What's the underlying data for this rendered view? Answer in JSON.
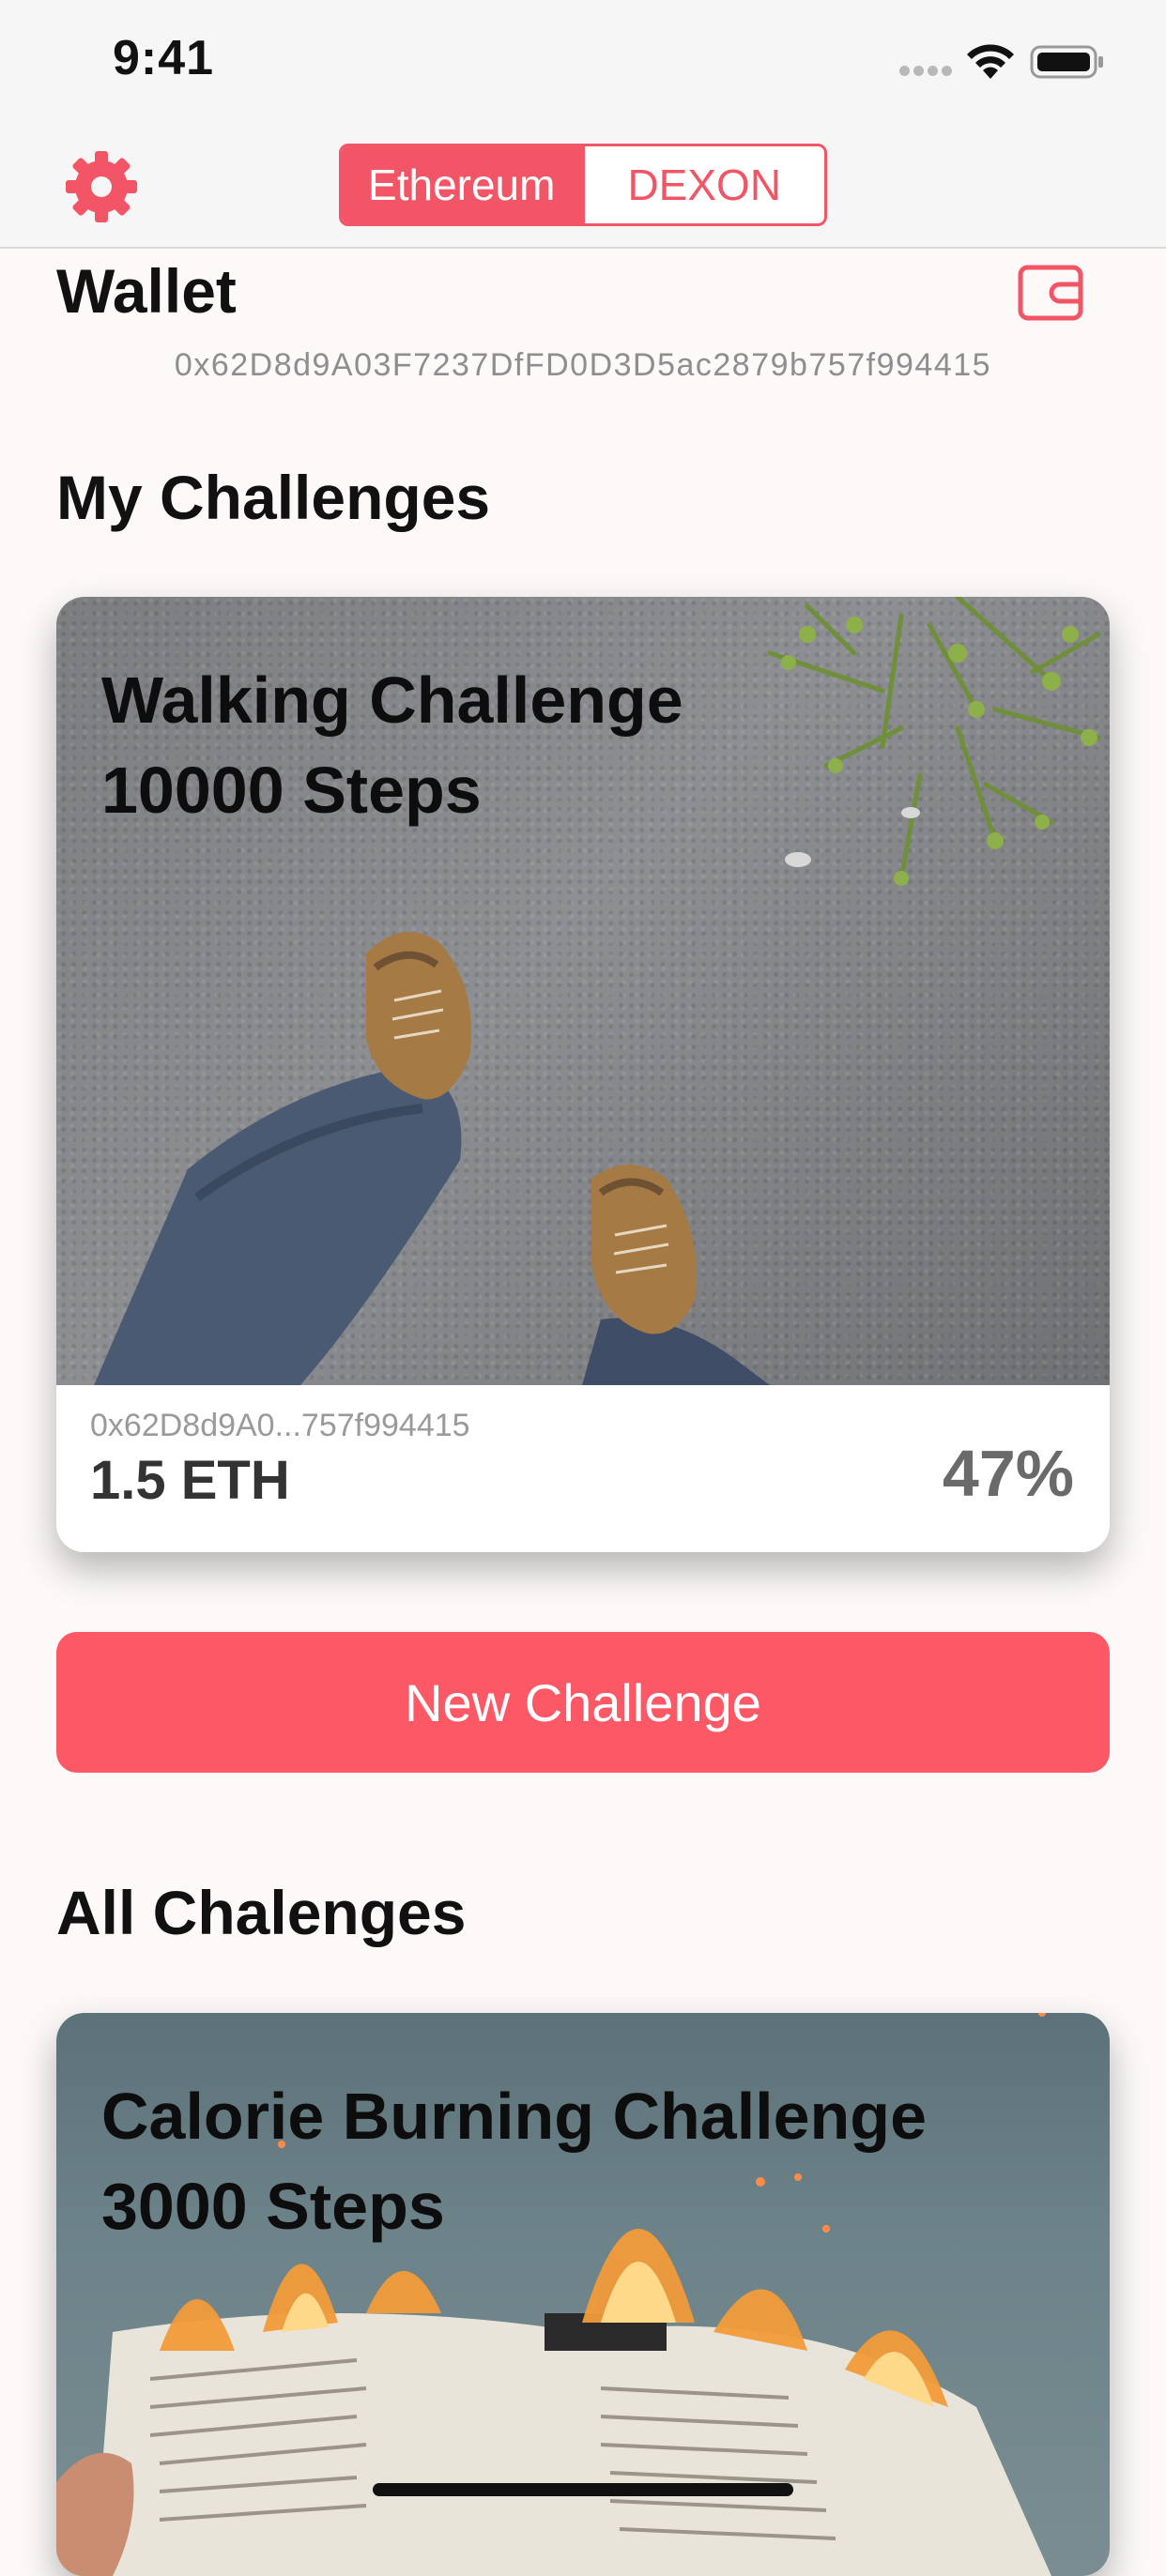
{
  "status_bar": {
    "time": "9:41"
  },
  "nav": {
    "segments": [
      {
        "label": "Ethereum",
        "selected": true
      },
      {
        "label": "DEXON",
        "selected": false
      }
    ],
    "settings_icon": "gear-icon"
  },
  "wallet": {
    "title": "Wallet",
    "address": "0x62D8d9A03F7237DfFD0D3D5ac2879b757f994415",
    "icon": "wallet-icon"
  },
  "my_challenges": {
    "title": "My Challenges",
    "card": {
      "title_line1": "Walking Challenge",
      "title_line2": "10000 Steps",
      "address": "0x62D8d9A0...757f994415",
      "amount": "1.5 ETH",
      "progress": "47%"
    }
  },
  "new_challenge_label": "New Challenge",
  "all_challenges": {
    "title": "All Chalenges",
    "cards": [
      {
        "title_line1": "Calorie Burning Challenge",
        "title_line2": "3000 Steps"
      }
    ]
  },
  "colors": {
    "accent": "#fd5866",
    "segment_accent": "#f25565",
    "background": "#fcf9f8"
  }
}
